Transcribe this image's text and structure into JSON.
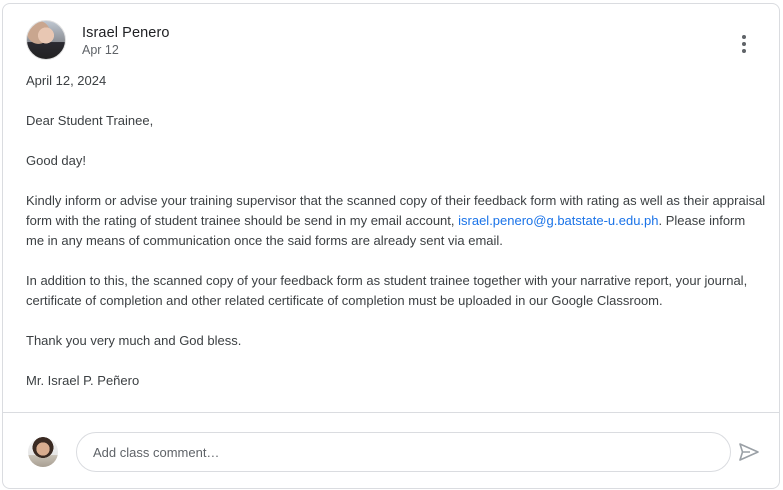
{
  "post": {
    "author": "Israel Penero",
    "posted_date": "Apr 12",
    "paragraphs": {
      "date_line": "April 12, 2024",
      "greeting": "Dear Student Trainee,",
      "good_day": "Good day!",
      "p1_before_link": "Kindly inform or advise your training supervisor that the scanned copy of their feedback form with rating as well as their appraisal form with the rating of student trainee should be send in my email account, ",
      "email_link": "israel.penero@g.batstate-u.edu.ph",
      "p1_after_link": ". Please inform me in any means of communication once the said forms are already sent via email.",
      "p2": "In addition to this, the scanned copy of your feedback form as student trainee together with your narrative report, your journal, certificate of completion and other related certificate of completion must be uploaded in our Google Classroom.",
      "thanks": "Thank you very much and God bless.",
      "signature": "Mr. Israel P. Peñero"
    }
  },
  "comment": {
    "placeholder": "Add class comment…"
  },
  "icons": {
    "more": "more-vert-icon",
    "send": "send-icon"
  },
  "colors": {
    "link": "#1a73e8",
    "text": "#3c4043",
    "border": "#dadce0"
  }
}
